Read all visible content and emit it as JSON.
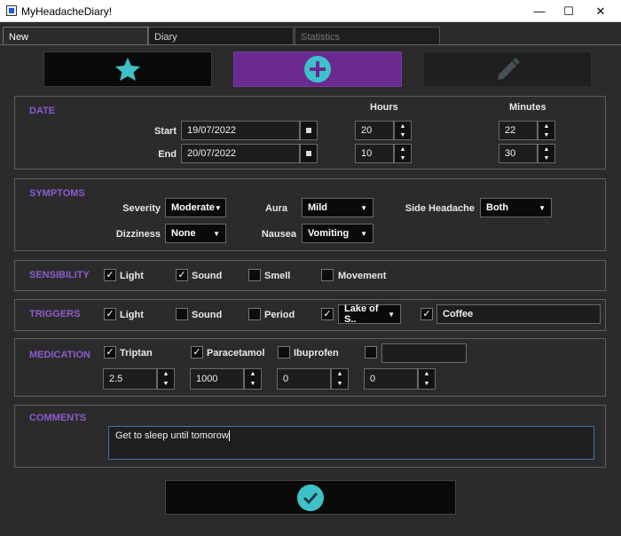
{
  "window": {
    "title": "MyHeadacheDiary!",
    "minimize": "—",
    "maximize": "☐",
    "close": "✕"
  },
  "tabs": [
    {
      "label": "New"
    },
    {
      "label": "Diary"
    },
    {
      "label": "Statistics"
    }
  ],
  "actions": {
    "favorite_icon": "star",
    "add_icon": "plus-circle",
    "edit_icon": "pencil"
  },
  "date": {
    "title": "DATE",
    "hours_label": "Hours",
    "minutes_label": "Minutes",
    "start_label": "Start",
    "start_date": "19/07/2022",
    "start_hours": "20",
    "start_minutes": "22",
    "end_label": "End",
    "end_date": "20/07/2022",
    "end_hours": "10",
    "end_minutes": "30"
  },
  "symptoms": {
    "title": "SYMPTOMS",
    "severity_label": "Severity",
    "severity_value": "Moderate",
    "aura_label": "Aura",
    "aura_value": "Mild",
    "side_label": "Side Headache",
    "side_value": "Both",
    "dizziness_label": "Dizziness",
    "dizziness_value": "None",
    "nausea_label": "Nausea",
    "nausea_value": "Vomiting"
  },
  "sensibility": {
    "title": "SENSIBILITY",
    "items": [
      {
        "label": "Light",
        "checked": true
      },
      {
        "label": "Sound",
        "checked": true
      },
      {
        "label": "Smell",
        "checked": false
      },
      {
        "label": "Movement",
        "checked": false
      }
    ]
  },
  "triggers": {
    "title": "TRIGGERS",
    "items": [
      {
        "label": "Light",
        "checked": true
      },
      {
        "label": "Sound",
        "checked": false
      },
      {
        "label": "Period",
        "checked": false
      }
    ],
    "combo_value": "Lake of S..",
    "custom_value": "Coffee"
  },
  "medication": {
    "title": "MEDICATION",
    "items": [
      {
        "label": "Triptan",
        "checked": true,
        "dose": "2.5"
      },
      {
        "label": "Paracetamol",
        "checked": true,
        "dose": "1000"
      },
      {
        "label": "Ibuprofen",
        "checked": false,
        "dose": "0"
      },
      {
        "label": "",
        "checked": false,
        "dose": "0"
      }
    ]
  },
  "comments": {
    "title": "COMMENTS",
    "text": "Get to sleep until tomorow"
  },
  "colors": {
    "accent_purple": "#8e5ccf",
    "icon_teal": "#3fc1c9",
    "button_purple": "#6a2a8f"
  }
}
